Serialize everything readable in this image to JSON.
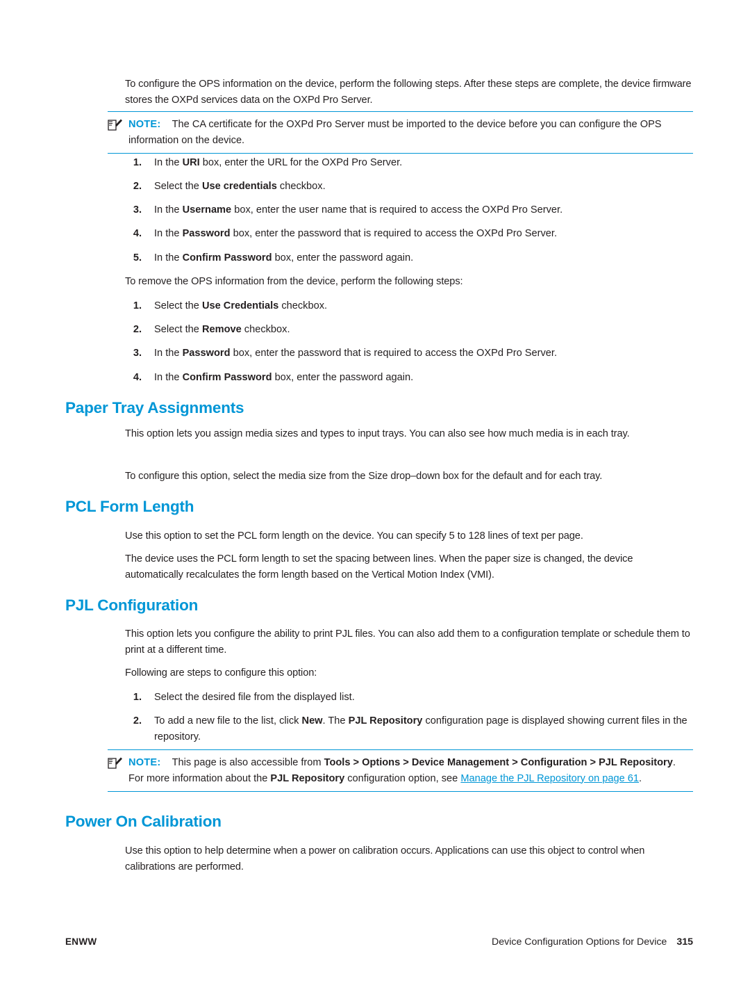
{
  "document": {
    "intro_paragraph": "To configure the OPS information on the device, perform the following steps. After these steps are complete, the device firmware stores the OXPd services data on the OXPd Pro Server.",
    "note1": {
      "label": "NOTE:",
      "text": "The CA certificate for the OXPd Pro Server must be imported to the device before you can configure the OPS information on the device.",
      "icon": "note-pencil-icon"
    },
    "list1": [
      {
        "num": "1.",
        "pre": "In the ",
        "bold": "URI",
        "post": " box, enter the URL for the OXPd Pro Server."
      },
      {
        "num": "2.",
        "pre": "Select the ",
        "bold": "Use credentials",
        "post": " checkbox."
      },
      {
        "num": "3.",
        "pre": "In the ",
        "bold": "Username",
        "post": " box, enter the user name that is required to access the OXPd Pro Server."
      },
      {
        "num": "4.",
        "pre": "In the ",
        "bold": "Password",
        "post": " box, enter the password that is required to access the OXPd Pro Server."
      },
      {
        "num": "5.",
        "pre": "In the ",
        "bold": "Confirm Password",
        "post": " box, enter the password again."
      }
    ],
    "remove_paragraph": "To remove the OPS information from the device, perform the following steps:",
    "list2": [
      {
        "num": "1.",
        "pre": "Select the ",
        "bold": "Use Credentials",
        "post": " checkbox."
      },
      {
        "num": "2.",
        "pre": "Select the ",
        "bold": "Remove",
        "post": " checkbox."
      },
      {
        "num": "3.",
        "pre": "In the ",
        "bold": "Password",
        "post": " box, enter the password that is required to access the OXPd Pro Server."
      },
      {
        "num": "4.",
        "pre": "In the ",
        "bold": "Confirm Password",
        "post": " box, enter the password again."
      }
    ],
    "section_paper_tray": {
      "heading": "Paper Tray Assignments",
      "para1": "This option lets you assign media sizes and types to input trays. You can also see how much media is in each tray.",
      "para2": "To configure this option, select the media size from the Size drop–down box for the default and for each tray."
    },
    "section_pcl": {
      "heading": "PCL Form Length",
      "para1": "Use this option to set the PCL form length on the device. You can specify 5 to 128 lines of text per page.",
      "para2": "The device uses the PCL form length to set the spacing between lines. When the paper size is changed, the device automatically recalculates the form length based on the Vertical Motion Index (VMI)."
    },
    "section_pjl": {
      "heading": "PJL Configuration",
      "para1": "This option lets you configure the ability to print PJL files. You can also add them to a configuration template or schedule them to print at a different time.",
      "para2": "Following are steps to configure this option:",
      "list": [
        {
          "num": "1.",
          "text": "Select the desired file from the displayed list."
        },
        {
          "num": "2.",
          "pre": "To add a new file to the list, click ",
          "bold1": "New",
          "mid": ". The ",
          "bold2": "PJL Repository",
          "post": " configuration page is displayed showing current files in the repository."
        }
      ],
      "note": {
        "label": "NOTE:",
        "seg1": "This page is also accessible from ",
        "bold_path": "Tools > Options > Device Management > Configuration > PJL Repository",
        "seg2": ". For more information about the ",
        "bold_repo": "PJL Repository",
        "seg3": " configuration option, see ",
        "link": "Manage the PJL Repository on page 61",
        "seg4": ".",
        "icon": "note-pencil-icon"
      }
    },
    "section_power_on": {
      "heading": "Power On Calibration",
      "para1": "Use this option to help determine when a power on calibration occurs. Applications can use this object to control when calibrations are performed."
    },
    "footer": {
      "left": "ENWW",
      "right": "Device Configuration Options for Device",
      "page": "315"
    },
    "colors": {
      "heading": "#0096d6",
      "text": "#231f20",
      "link": "#0096d6"
    }
  }
}
